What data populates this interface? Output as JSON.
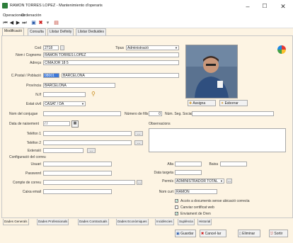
{
  "window": {
    "title": "RAMON TORRES LOPEZ - Mantenimiento d'operaris",
    "minimize": "–",
    "maximize": "☐",
    "close": "✕"
  },
  "menu": [
    "Operaciones",
    "Ordenación"
  ],
  "tabs_top": [
    "Modificació",
    "Consulta",
    "Llistar Definity",
    "Llistar Dediuides"
  ],
  "form": {
    "cod": {
      "label": "Cod",
      "value": "2718"
    },
    "tipus": {
      "label": "Tipus",
      "value": "Administració"
    },
    "nom": {
      "label": "Nom i Cognoms",
      "value": "RAMON TORRES LOPEZ"
    },
    "adreca": {
      "label": "Adreça",
      "value": "C/MAJOR 18 5"
    },
    "cpostal": {
      "label": "C.Postal / Població",
      "value": "08001",
      "poblacio": "BARCELONA"
    },
    "provincia": {
      "label": "Província",
      "value": "BARCELONA"
    },
    "nif": {
      "label": "N.If"
    },
    "estat_civil": {
      "label": "Estat civil",
      "value": "CASAT / DA"
    },
    "nom_conjuge": {
      "label": "Nom del conjugue"
    },
    "numero_fills": {
      "label": "Número de fills",
      "value": "0"
    },
    "num_seg_social": {
      "label": "Núm. Seg. Social"
    },
    "data_naixement": {
      "label": "Data de naixement",
      "value": "/ /"
    },
    "telefon1": {
      "label": "Telèfon 1"
    },
    "telefon2": {
      "label": "Telèfon 2"
    },
    "extensio": {
      "label": "Extensió"
    },
    "observacions": {
      "label": "Observacions"
    },
    "config_email": {
      "label": "Configuració del correu"
    },
    "usuari": {
      "label": "Usuari"
    },
    "password": {
      "label": "Password"
    },
    "compte_correu": {
      "label": "Compte de correu"
    },
    "caixa_email": {
      "label": "Caixa email"
    },
    "alta": {
      "label": "Alta"
    },
    "baixa": {
      "label": "Baixa"
    },
    "data_targeta": {
      "label": "Data targeta"
    },
    "permis": {
      "label": "Permís",
      "value": "ADMINISTRADOR TOTAL"
    },
    "nom_curt": {
      "label": "Nom curt",
      "value": "RAMON"
    },
    "checks": [
      {
        "label": "Accés a documents sense ubicació correcta",
        "checked": true
      },
      {
        "label": "Canviar certificat web",
        "checked": false
      },
      {
        "label": "Enviament de Dren",
        "checked": true
      }
    ]
  },
  "photo_buttons": {
    "assign": "Assigna",
    "delete": "Esborrar"
  },
  "tabs_bottom": [
    "Dades Generals",
    "Dades Professionals",
    "Dades Contractuals",
    "Dades Econòmiques",
    "Incidències",
    "Suplència",
    "Historial"
  ],
  "footer": {
    "save": "Guardar",
    "cancel": "Cancel·lar",
    "delete": "Eliminar",
    "exit": "Sortir"
  }
}
